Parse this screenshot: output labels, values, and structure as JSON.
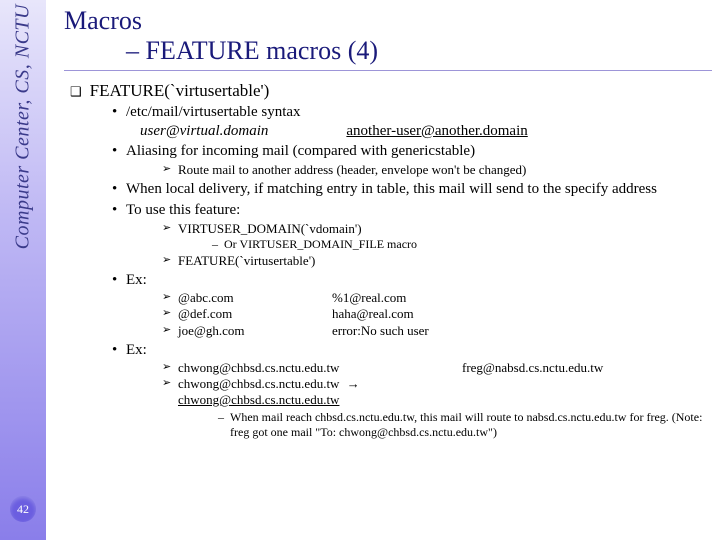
{
  "rail": {
    "label": "Computer Center, CS, NCTU"
  },
  "page": {
    "number": "42"
  },
  "title": {
    "line1": "Macros",
    "line2": "– FEATURE macros (4)"
  },
  "section": {
    "heading": "FEATURE(`virtusertable')"
  },
  "body": {
    "syntax": {
      "label": "/etc/mail/virtusertable syntax",
      "col1": "user@virtual.domain",
      "col2": "another-user@another.domain"
    },
    "aliasing": "Aliasing for incoming mail (compared with genericstable)",
    "aliasing_sub": [
      "Route mail to another address (header, envelope won't be changed)"
    ],
    "local_delivery": "When local delivery, if matching entry in table, this mail will send to the specify address",
    "use_feature": {
      "label": "To use this feature:",
      "sub": [
        "VIRTUSER_DOMAIN(`vdomain')",
        "FEATURE(`virtusertable')"
      ],
      "subsub": [
        "Or VIRTUSER_DOMAIN_FILE macro"
      ]
    },
    "ex1": {
      "label": "Ex:",
      "rows": [
        [
          "@abc.com",
          "%1@real.com"
        ],
        [
          "@def.com",
          "haha@real.com"
        ],
        [
          "joe@gh.com",
          "error:No such user"
        ]
      ]
    },
    "ex2": {
      "label": "Ex:",
      "rows": [
        [
          "chwong@chbsd.cs.nctu.edu.tw",
          "freg@nabsd.cs.nctu.edu.tw"
        ],
        [
          "chwong@chbsd.cs.nctu.edu.tw",
          "chwong@chbsd.cs.nctu.edu.tw"
        ]
      ],
      "note": "When mail reach chbsd.cs.nctu.edu.tw, this mail will route to nabsd.cs.nctu.edu.tw for freg. (Note: freg got one mail \"To: chwong@chbsd.cs.nctu.edu.tw\")"
    }
  }
}
